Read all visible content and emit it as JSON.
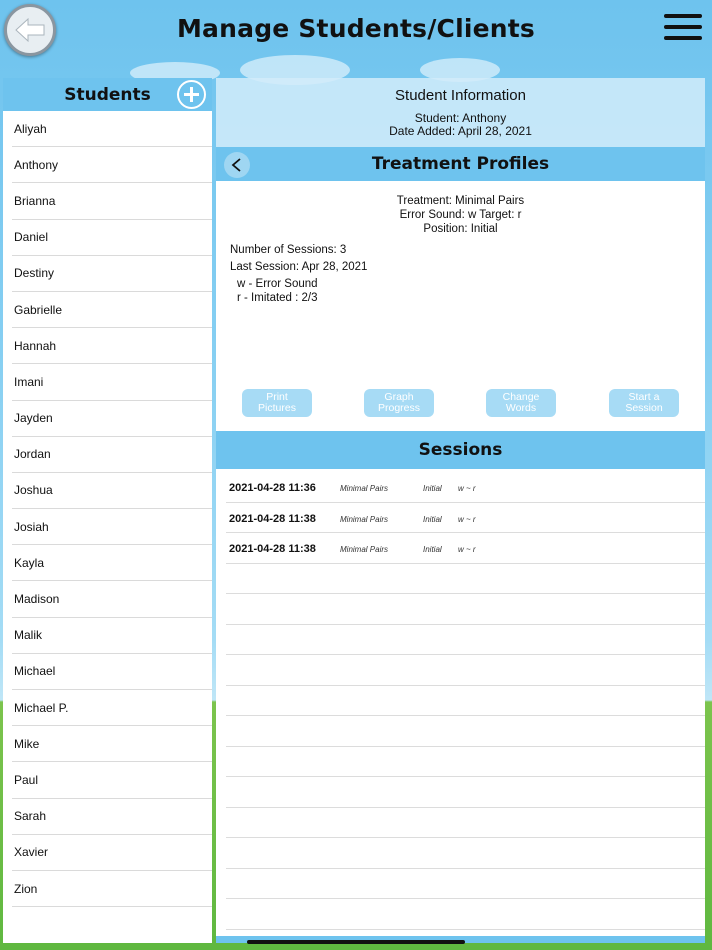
{
  "header": {
    "title": "Manage Students/Clients",
    "back_icon": "arrow-left-icon",
    "menu_icon": "hamburger-icon"
  },
  "students": {
    "title": "Students",
    "add_icon": "plus-circle-icon",
    "items": [
      "Aliyah",
      "Anthony",
      "Brianna",
      "Daniel",
      "Destiny",
      "Gabrielle",
      "Hannah",
      "Imani",
      "Jayden",
      "Jordan",
      "Joshua",
      "Josiah",
      "Kayla",
      "Madison",
      "Malik",
      "Michael",
      "Michael P.",
      "Mike",
      "Paul",
      "Sarah",
      "Xavier",
      "Zion"
    ]
  },
  "student_info": {
    "title": "Student Information",
    "student": "Student: Anthony",
    "date_added": "Date Added: April 28, 2021"
  },
  "treatment": {
    "title": "Treatment Profiles",
    "back_icon": "chevron-left-icon",
    "treatment": "Treatment: Minimal Pairs",
    "error_target": "Error Sound: w  Target: r",
    "position": "Position: Initial",
    "num_sessions": "Number of Sessions: 3",
    "last_session": "Last Session: Apr 28, 2021",
    "detail_1": "w - Error Sound",
    "detail_2": "r - Imitated : 2/3",
    "buttons": [
      {
        "line1": "Print",
        "line2": "Pictures"
      },
      {
        "line1": "Graph",
        "line2": "Progress"
      },
      {
        "line1": "Change",
        "line2": "Words"
      },
      {
        "line1": "Start a",
        "line2": "Session"
      }
    ]
  },
  "sessions": {
    "title": "Sessions",
    "rows": [
      {
        "datetime": "2021-04-28  11:36",
        "treatment": "Minimal Pairs",
        "position": "Initial",
        "sounds": "w ~ r"
      },
      {
        "datetime": "2021-04-28  11:38",
        "treatment": "Minimal Pairs",
        "position": "Initial",
        "sounds": "w ~ r"
      },
      {
        "datetime": "2021-04-28  11:38",
        "treatment": "Minimal Pairs",
        "position": "Initial",
        "sounds": "w ~ r"
      },
      {
        "datetime": "",
        "treatment": "",
        "position": "",
        "sounds": ""
      },
      {
        "datetime": "",
        "treatment": "",
        "position": "",
        "sounds": ""
      },
      {
        "datetime": "",
        "treatment": "",
        "position": "",
        "sounds": ""
      },
      {
        "datetime": "",
        "treatment": "",
        "position": "",
        "sounds": ""
      },
      {
        "datetime": "",
        "treatment": "",
        "position": "",
        "sounds": ""
      },
      {
        "datetime": "",
        "treatment": "",
        "position": "",
        "sounds": ""
      },
      {
        "datetime": "",
        "treatment": "",
        "position": "",
        "sounds": ""
      },
      {
        "datetime": "",
        "treatment": "",
        "position": "",
        "sounds": ""
      },
      {
        "datetime": "",
        "treatment": "",
        "position": "",
        "sounds": ""
      },
      {
        "datetime": "",
        "treatment": "",
        "position": "",
        "sounds": ""
      },
      {
        "datetime": "",
        "treatment": "",
        "position": "",
        "sounds": ""
      },
      {
        "datetime": "",
        "treatment": "",
        "position": "",
        "sounds": ""
      },
      {
        "datetime": "",
        "treatment": "",
        "position": "",
        "sounds": ""
      }
    ]
  },
  "colors": {
    "sky": "#6ec3ee",
    "panel_header": "#6ec3ee",
    "button_fill": "#a7dbf5",
    "grass": "#5fb840"
  }
}
